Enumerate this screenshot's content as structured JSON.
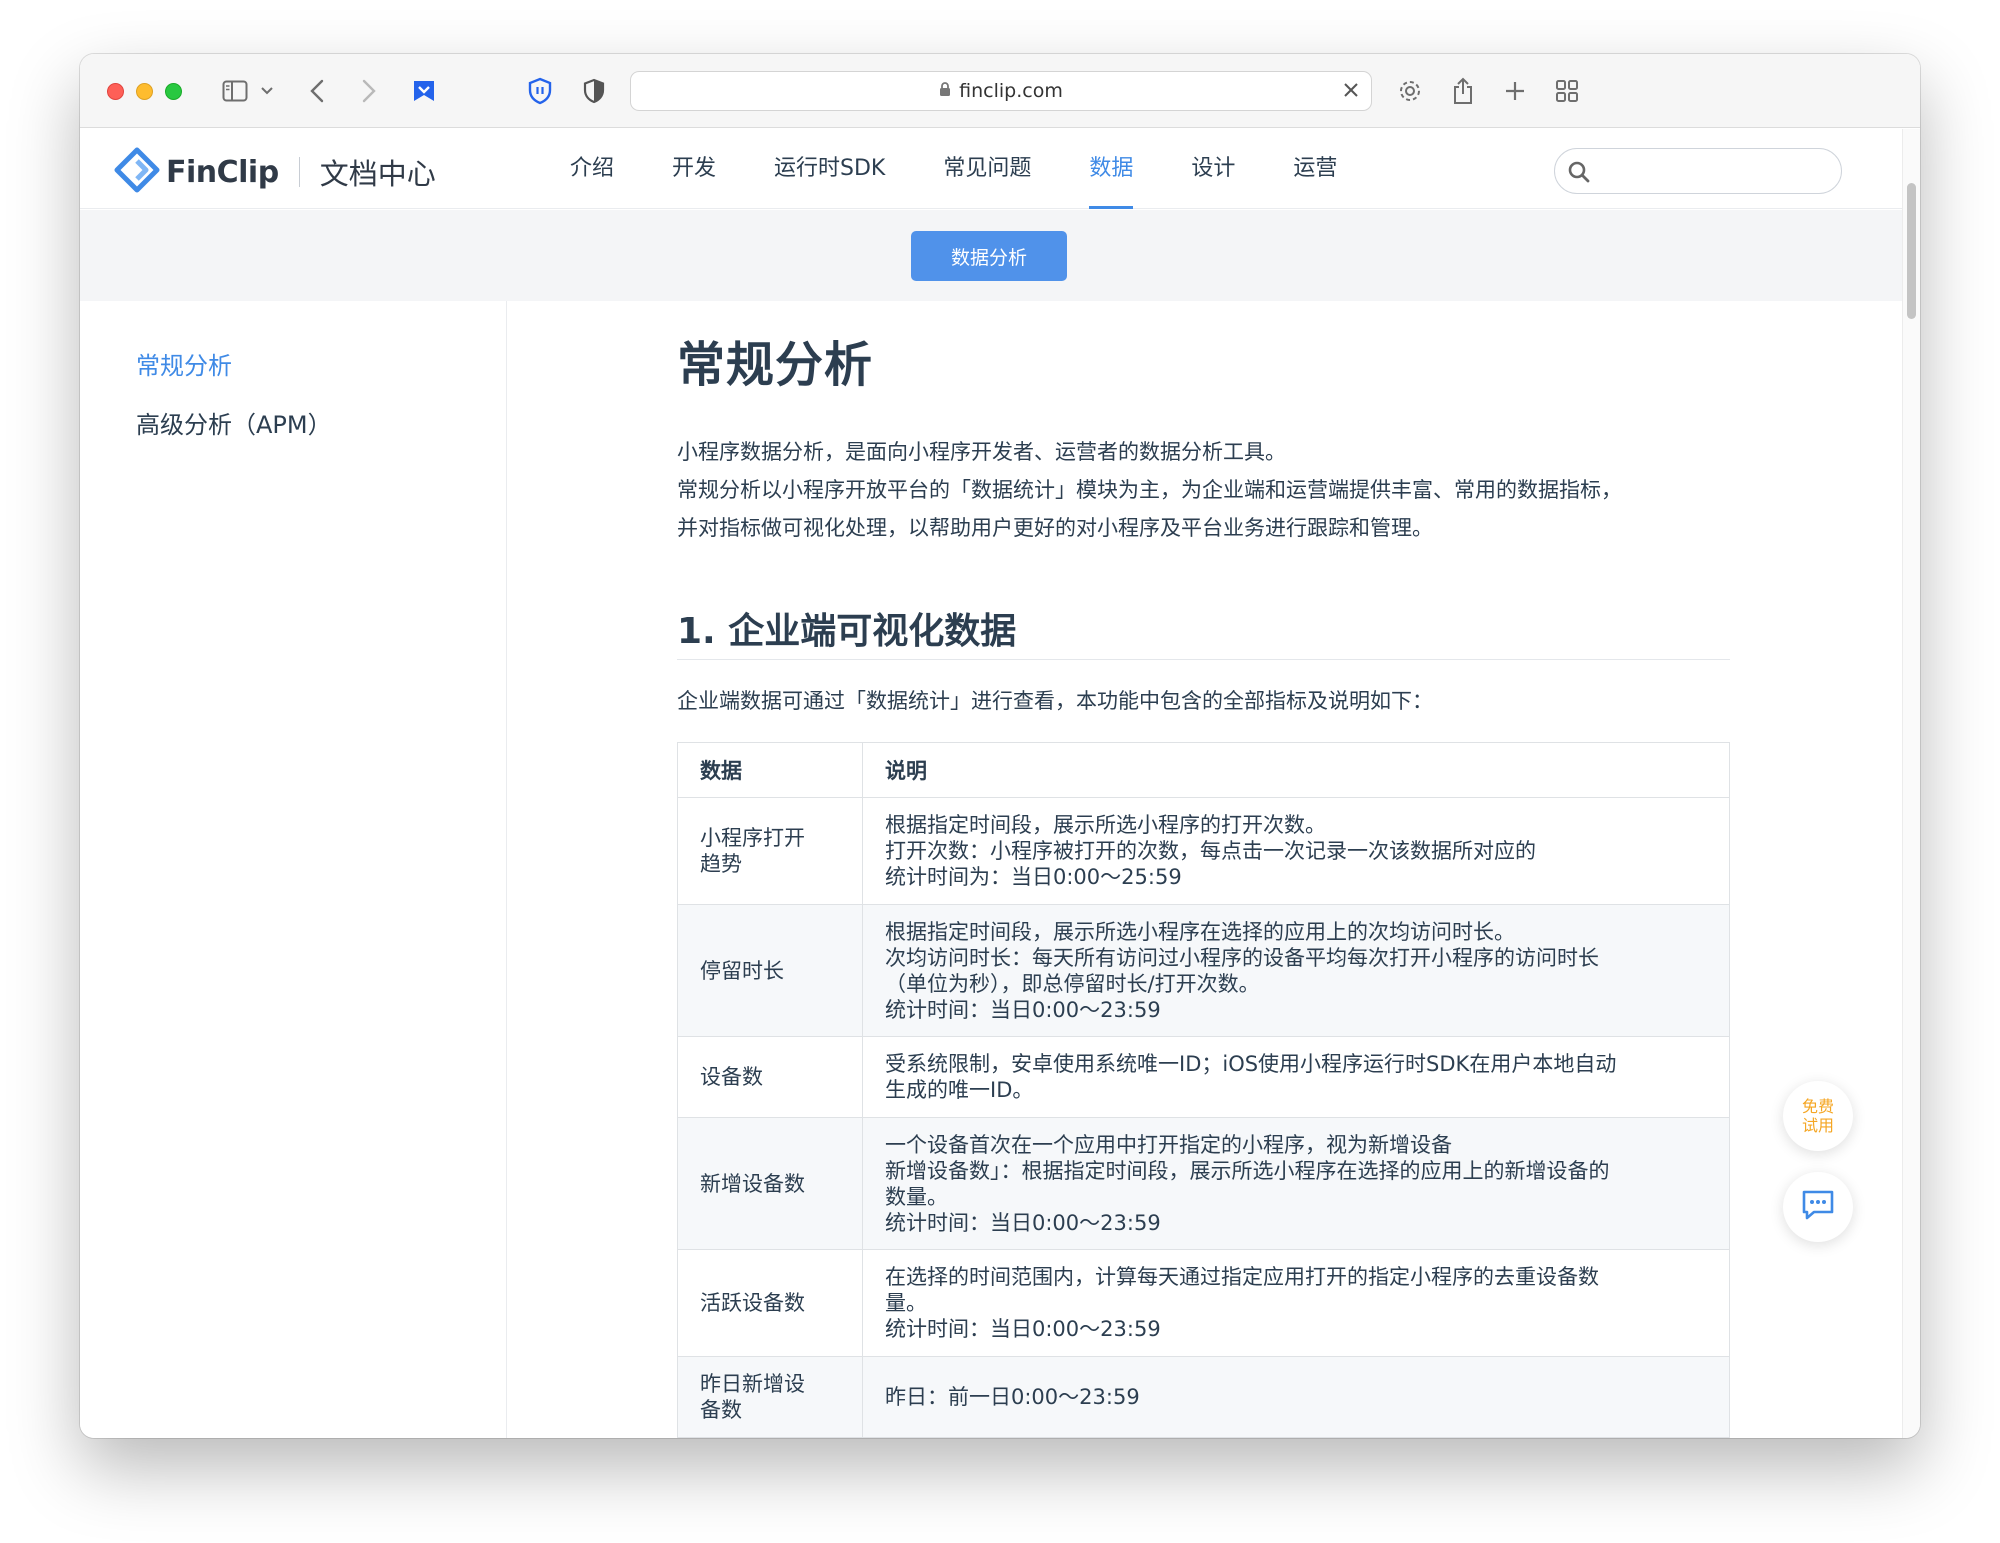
{
  "browser": {
    "url": "finclip.com"
  },
  "header": {
    "logo_text": "FinClip",
    "logo_sub": "文档中心",
    "nav": [
      {
        "label": "介绍"
      },
      {
        "label": "开发"
      },
      {
        "label": "运行时SDK"
      },
      {
        "label": "常见问题"
      },
      {
        "label": "数据",
        "active": true
      },
      {
        "label": "设计"
      },
      {
        "label": "运营"
      }
    ],
    "search_placeholder": ""
  },
  "subnav": {
    "button_label": "数据分析"
  },
  "sidebar": {
    "items": [
      {
        "label": "常规分析",
        "active": true
      },
      {
        "label": "高级分析（APM）"
      }
    ]
  },
  "main": {
    "title": "常规分析",
    "intro": [
      "小程序数据分析，是面向小程序开发者、运营者的数据分析工具。",
      "常规分析以小程序开放平台的「数据统计」模块为主，为企业端和运营端提供丰富、常用的数据指标，",
      "并对指标做可视化处理，以帮助用户更好的对小程序及平台业务进行跟踪和管理。"
    ],
    "section_title": "1. 企业端可视化数据",
    "section_desc": "企业端数据可通过「数据统计」进行查看，本功能中包含的全部指标及说明如下：",
    "table": {
      "headers": [
        "数据",
        "说明"
      ],
      "rows": [
        {
          "name": [
            "小程序打开",
            "趋势"
          ],
          "desc": [
            "根据指定时间段，展示所选小程序的打开次数。",
            "打开次数：小程序被打开的次数，每点击一次记录一次该数据所对应的",
            "统计时间为：当日0:00～25:59"
          ]
        },
        {
          "name": [
            "停留时长"
          ],
          "desc": [
            "根据指定时间段，展示所选小程序在选择的应用上的次均访问时长。",
            "次均访问时长：每天所有访问过小程序的设备平均每次打开小程序的访问时长",
            "（单位为秒），即总停留时长/打开次数。",
            "统计时间：当日0:00～23:59"
          ]
        },
        {
          "name": [
            "设备数"
          ],
          "desc": [
            "受系统限制，安卓使用系统唯一ID；iOS使用小程序运行时SDK在用户本地自动",
            "生成的唯一ID。"
          ]
        },
        {
          "name": [
            "新增设备数"
          ],
          "desc": [
            "一个设备首次在一个应用中打开指定的小程序，视为新增设备",
            "新增设备数」：根据指定时间段，展示所选小程序在选择的应用上的新增设备的",
            "数量。",
            "统计时间：当日0:00～23:59"
          ]
        },
        {
          "name": [
            "活跃设备数"
          ],
          "desc": [
            "在选择的时间范围内，计算每天通过指定应用打开的指定小程序的去重设备数",
            "量。",
            "统计时间：当日0:00～23:59"
          ]
        },
        {
          "name": [
            "昨日新增设",
            "备数"
          ],
          "desc": [
            "昨日：前一日0:00～23:59"
          ]
        }
      ]
    }
  },
  "floating": {
    "trial_label": "免费试用"
  }
}
